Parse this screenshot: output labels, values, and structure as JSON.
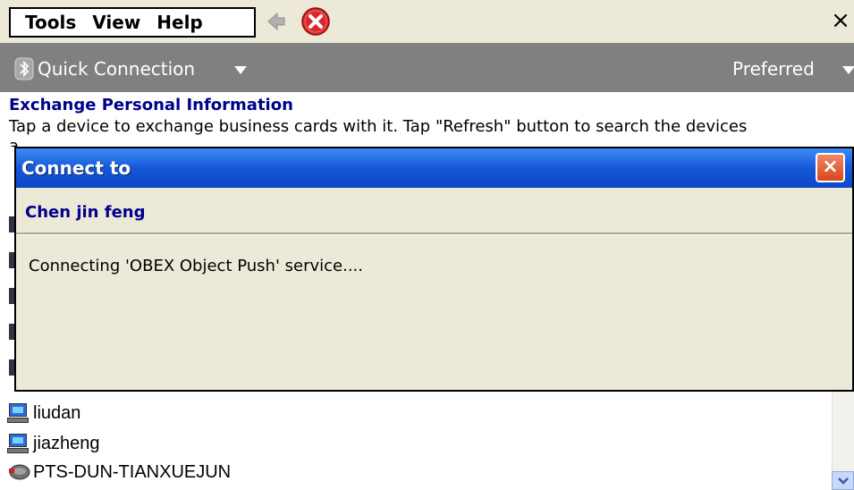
{
  "menu": {
    "items": [
      "Tools",
      "View",
      "Help"
    ],
    "close_label": "×"
  },
  "toolbar": {
    "quick_connection": "Quick Connection",
    "preferred": "Preferred"
  },
  "section": {
    "title": "Exchange Personal Information",
    "description": "Tap a device to exchange business cards with it. Tap \"Refresh\" button to search the devices",
    "description_overflow": "a"
  },
  "devices": [
    {
      "name": "liudan",
      "icon": "computer-icon"
    },
    {
      "name": "jiazheng",
      "icon": "computer-icon"
    },
    {
      "name": "PTS-DUN-TIANXUEJUN",
      "icon": "phone-device-icon"
    }
  ],
  "dialog": {
    "title": "Connect to",
    "close_label": "×",
    "device_name": "Chen jin feng",
    "status": "Connecting 'OBEX Object Push' service...."
  },
  "colors": {
    "title_blue": "#00008b",
    "titlebar": "#1658d8",
    "dialog_bg": "#ece9d8",
    "toolbar_bg": "#808080"
  }
}
